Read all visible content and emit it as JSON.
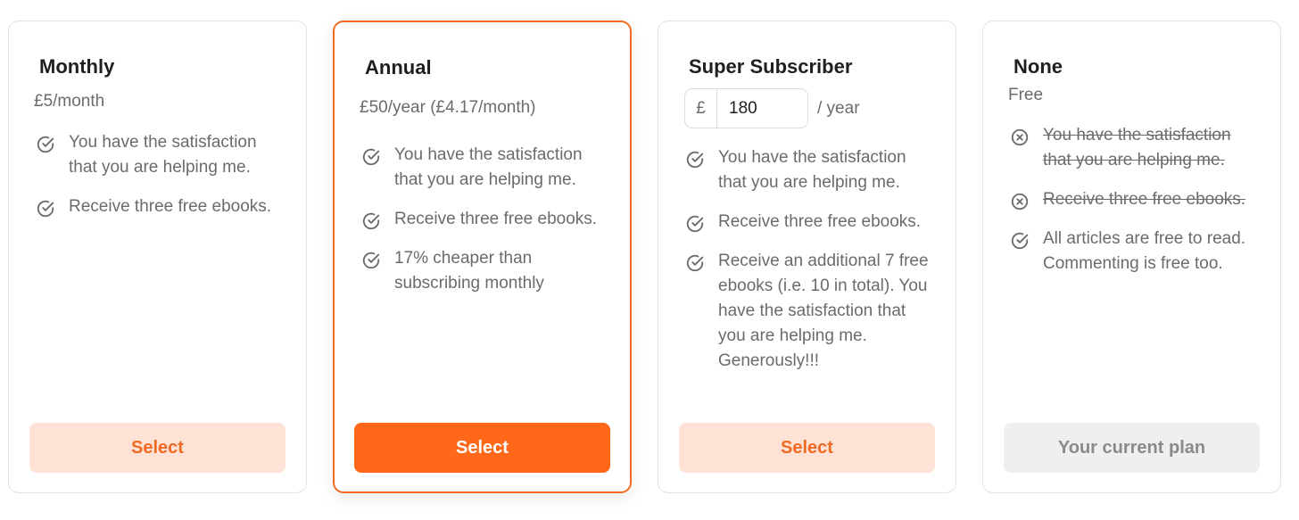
{
  "plans": [
    {
      "title": "Monthly",
      "price": "£5/month",
      "features": [
        {
          "text": "You have the satisfaction that you are helping me.",
          "icon": "check-circle-icon",
          "struck": false
        },
        {
          "text": "Receive three free ebooks.",
          "icon": "check-circle-icon",
          "struck": false
        }
      ],
      "button": "Select"
    },
    {
      "title": "Annual",
      "price": "£50/year (£4.17/month)",
      "features": [
        {
          "text": "You have the satisfaction that you are helping me.",
          "icon": "check-circle-icon",
          "struck": false
        },
        {
          "text": "Receive three free ebooks.",
          "icon": "check-circle-icon",
          "struck": false
        },
        {
          "text": "17% cheaper than subscribing monthly",
          "icon": "check-circle-icon",
          "struck": false
        }
      ],
      "button": "Select"
    },
    {
      "title": "Super Subscriber",
      "currency_symbol": "£",
      "amount": "180",
      "period": "/ year",
      "features": [
        {
          "text": "You have the satisfaction that you are helping me.",
          "icon": "check-circle-icon",
          "struck": false
        },
        {
          "text": "Receive three free ebooks.",
          "icon": "check-circle-icon",
          "struck": false
        },
        {
          "text": "Receive an additional 7 free ebooks (i.e. 10 in total). You have the satisfaction that you are helping me. Generously!!!",
          "icon": "check-circle-icon",
          "struck": false
        }
      ],
      "button": "Select"
    },
    {
      "title": "None",
      "price": "Free",
      "features": [
        {
          "text": "You have the satisfaction that you are helping me.",
          "icon": "x-circle-icon",
          "struck": true
        },
        {
          "text": "Receive three free ebooks.",
          "icon": "x-circle-icon",
          "struck": true
        },
        {
          "text": "All articles are free to read. Commenting is free too.",
          "icon": "check-circle-icon",
          "struck": false
        }
      ],
      "button": "Your current plan"
    }
  ],
  "colors": {
    "accent": "#ff6819",
    "accent_light": "#fde2d5",
    "accent_border": "#f26a24",
    "muted_text": "#6b6b6b",
    "disabled_bg": "#efefef"
  }
}
